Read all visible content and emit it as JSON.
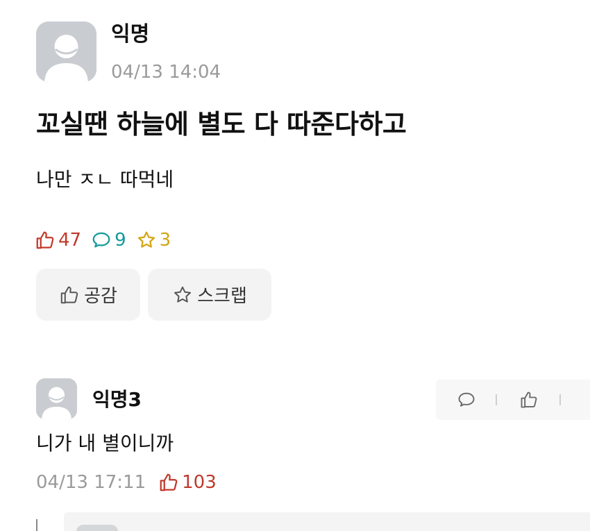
{
  "post": {
    "author": "익명",
    "time": "04/13 14:04",
    "title": "꼬실땐 하늘에 별도 다 따준다하고",
    "body": "나만 ㅈㄴ 따먹네",
    "stats": {
      "likes": "47",
      "comments": "9",
      "scraps": "3"
    },
    "actions": {
      "empathy_label": "공감",
      "scrap_label": "스크랩"
    }
  },
  "comment": {
    "author": "익명3",
    "body": "니가 내 별이니까",
    "time": "04/13 17:11",
    "likes": "103"
  },
  "colors": {
    "like": "#c0392b",
    "comment": "#139a9a",
    "scrap": "#d4a514",
    "meta_gray": "#9a9a9a",
    "avatar_bg": "#c9ccd1"
  },
  "icons": {
    "avatar": "user-avatar-icon",
    "like": "thumbs-up-icon",
    "comment": "speech-bubble-icon",
    "scrap": "star-icon"
  }
}
